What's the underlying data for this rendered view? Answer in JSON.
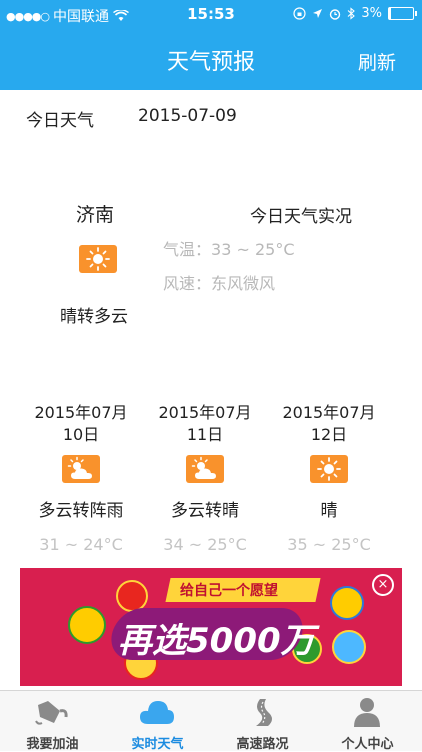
{
  "status_bar": {
    "carrier": "中国联通",
    "time": "15:53",
    "battery": "3%",
    "battery_level": 0.03
  },
  "nav": {
    "title": "天气预报",
    "refresh_label": "刷新"
  },
  "today": {
    "label": "今日天气",
    "date": "2015-07-09",
    "city": "济南",
    "live_label": "今日天气实况",
    "temp_label": "气温：",
    "temp_value": "33 ~ 25°C",
    "wind_label": "风速：",
    "wind_value": "东风微风",
    "condition": "晴转多云",
    "icon": "sun-icon"
  },
  "forecast": [
    {
      "date_line1": "2015年07月",
      "date_line2": "10日",
      "condition": "多云转阵雨",
      "range": "31 ~ 24°C",
      "icon": "partly-cloudy-icon"
    },
    {
      "date_line1": "2015年07月",
      "date_line2": "11日",
      "condition": "多云转晴",
      "range": "34 ~ 25°C",
      "icon": "partly-cloudy-icon"
    },
    {
      "date_line1": "2015年07月",
      "date_line2": "12日",
      "condition": "晴",
      "range": "35 ~ 25°C",
      "icon": "sun-icon"
    }
  ],
  "ad": {
    "banner_text": "给自己一个愿望",
    "headline": "再选5000万",
    "close_symbol": "×"
  },
  "tabbar": {
    "items": [
      {
        "label": "我要加油",
        "icon": "fuel-icon"
      },
      {
        "label": "实时天气",
        "icon": "cloud-icon",
        "active": true
      },
      {
        "label": "高速路况",
        "icon": "road-icon"
      },
      {
        "label": "个人中心",
        "icon": "user-icon"
      }
    ]
  },
  "colors": {
    "primary": "#28a9ee",
    "weather_icon_bg": "#f9922c",
    "ad_bg": "#d81f4f",
    "active_tab": "#1a8be0"
  }
}
